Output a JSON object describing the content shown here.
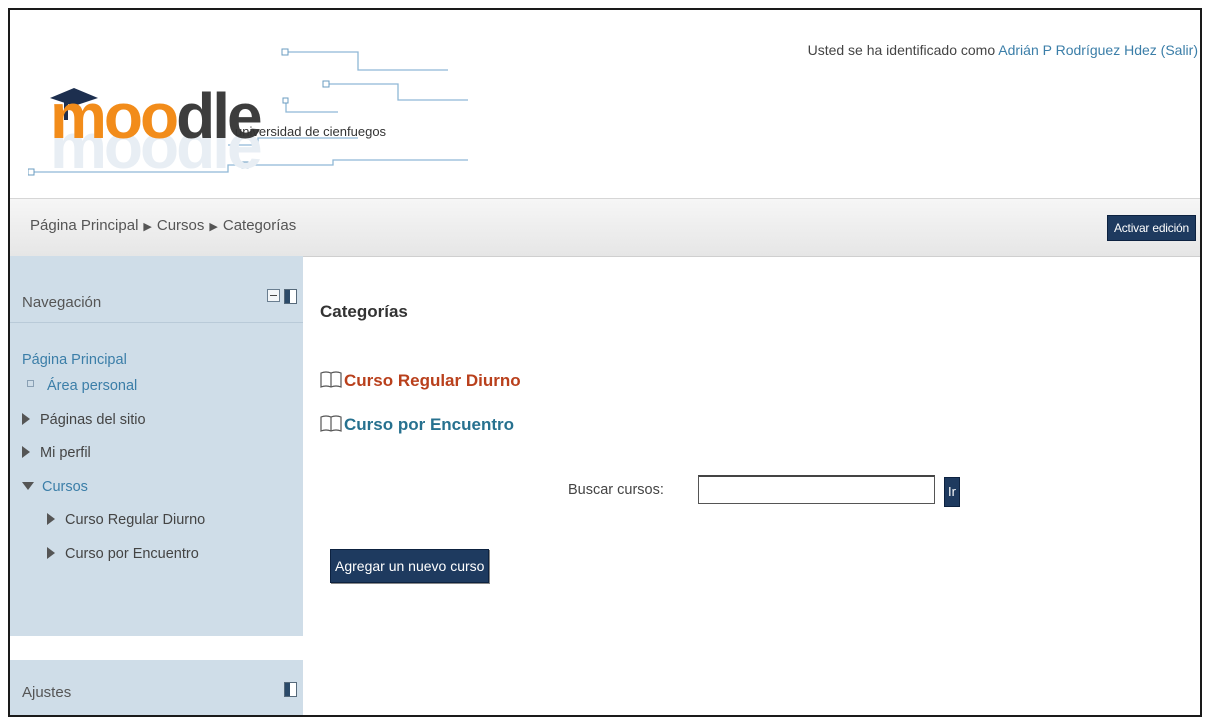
{
  "header": {
    "logo_word": "moodle",
    "logo_subtitle": "universidad de cienfuegos",
    "login_prefix": "Usted se ha identificado como",
    "user_name": "Adrián P Rodríguez Hdez",
    "logout_label": "(Salir)"
  },
  "navbar": {
    "breadcrumb": [
      "Página Principal",
      "Cursos",
      "Categorías"
    ],
    "edit_button": "Activar edición"
  },
  "sidebar": {
    "navigation": {
      "title": "Navegación",
      "home": "Página Principal",
      "items": [
        {
          "label": "Área personal"
        },
        {
          "label": "Páginas del sitio"
        },
        {
          "label": "Mi perfil"
        },
        {
          "label": "Cursos"
        },
        {
          "label": "Curso Regular Diurno"
        },
        {
          "label": "Curso por Encuentro"
        }
      ]
    },
    "settings": {
      "title": "Ajustes"
    }
  },
  "main": {
    "title": "Categorías",
    "categories": [
      {
        "label": "Curso Regular Diurno",
        "color": "#b9401c"
      },
      {
        "label": "Curso por Encuentro",
        "color": "#27718f"
      }
    ],
    "search": {
      "label": "Buscar cursos:",
      "value": "",
      "button": "Ir"
    },
    "add_course_button": "Agregar un nuevo curso"
  },
  "colors": {
    "link": "#3b7ea8",
    "button": "#1e3a5f",
    "sidebar_bg": "#cfdde8"
  }
}
